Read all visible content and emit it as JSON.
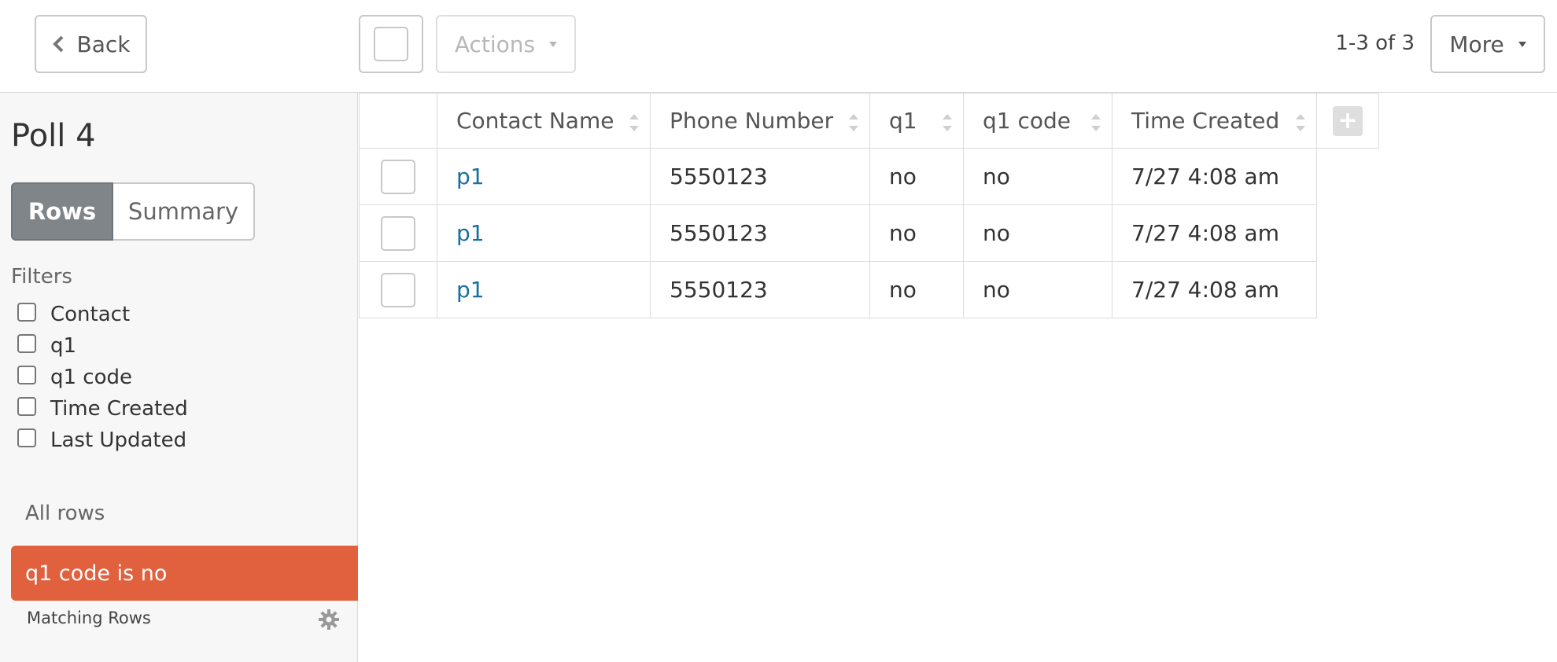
{
  "toolbar": {
    "back_label": "Back",
    "actions_label": "Actions",
    "page_count": "1-3 of 3",
    "more_label": "More"
  },
  "sidebar": {
    "title": "Poll 4",
    "toggle": {
      "rows": "Rows",
      "summary": "Summary",
      "selected": "Rows"
    },
    "filters_label": "Filters",
    "filters": [
      {
        "label": "Contact",
        "checked": false
      },
      {
        "label": "q1",
        "checked": false
      },
      {
        "label": "q1 code",
        "checked": false
      },
      {
        "label": "Time Created",
        "checked": false
      },
      {
        "label": "Last Updated",
        "checked": false
      }
    ],
    "all_rows_label": "All rows",
    "active_filter": "q1 code is no",
    "matching_label": "Matching Rows"
  },
  "table": {
    "columns": [
      "Contact Name",
      "Phone Number",
      "q1",
      "q1 code",
      "Time Created"
    ],
    "rows": [
      {
        "contact_name": "p1",
        "phone_number": "5550123",
        "q1": "no",
        "q1_code": "no",
        "time_created": "7/27 4:08 am"
      },
      {
        "contact_name": "p1",
        "phone_number": "5550123",
        "q1": "no",
        "q1_code": "no",
        "time_created": "7/27 4:08 am"
      },
      {
        "contact_name": "p1",
        "phone_number": "5550123",
        "q1": "no",
        "q1_code": "no",
        "time_created": "7/27 4:08 am"
      }
    ],
    "add_column_icon": "plus-icon"
  },
  "colors": {
    "accent_filter": "#e1613f",
    "link": "#19709c",
    "toggle_selected": "#7f8589"
  }
}
